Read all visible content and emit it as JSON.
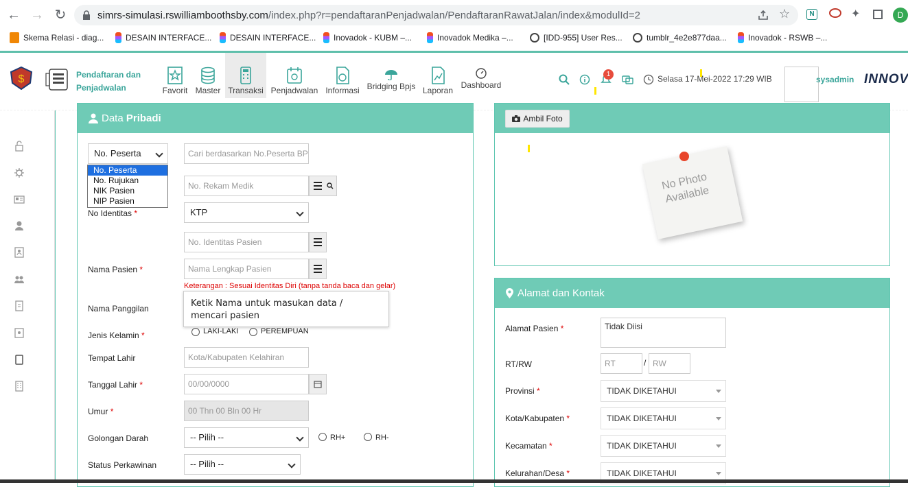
{
  "browser": {
    "url_host": "simrs-simulasi.rswilliamboothsby.com",
    "url_path": "/index.php?r=pendaftaranPenjadwalan/PendaftaranRawatJalan/index&modulId=2",
    "profile_initial": "D",
    "bookmarks": [
      {
        "label": "Skema Relasi - diag...",
        "icon": "drawio-icon"
      },
      {
        "label": "DESAIN INTERFACE...",
        "icon": "figma-icon"
      },
      {
        "label": "DESAIN INTERFACE...",
        "icon": "figma-icon"
      },
      {
        "label": "Inovadok - KUBM –...",
        "icon": "figma-icon"
      },
      {
        "label": "Inovadok Medika –...",
        "icon": "figma-icon"
      },
      {
        "label": "[IDD-955] User Res...",
        "icon": "globe-icon"
      },
      {
        "label": "tumblr_4e2e877daa...",
        "icon": "globe-icon"
      },
      {
        "label": "Inovadok - RSWB –...",
        "icon": "figma-icon"
      }
    ]
  },
  "header": {
    "module_title_line1": "Pendaftaran dan",
    "module_title_line2": "Penjadwalan",
    "menu": [
      {
        "label": "Favorit",
        "icon": "star-icon"
      },
      {
        "label": "Master",
        "icon": "database-icon"
      },
      {
        "label": "Transaksi",
        "icon": "calculator-icon"
      },
      {
        "label": "Penjadwalan",
        "icon": "calendar-icon"
      },
      {
        "label": "Informasi",
        "icon": "info-icon"
      },
      {
        "label": "Bridging Bpjs",
        "icon": "umbrella-icon"
      },
      {
        "label": "Laporan",
        "icon": "report-icon"
      },
      {
        "label": "Dashboard",
        "icon": "dashboard-icon"
      }
    ],
    "notification_count": "1",
    "datetime": "Selasa 17-Mei-2022 17:29 WIB",
    "username": "sysadmin",
    "brand": "INNOV"
  },
  "data_pribadi": {
    "title_light": "Data",
    "title_bold": "Pribadi",
    "id_type_selected": "No. Peserta",
    "id_type_options": [
      "No. Peserta",
      "No. Rujukan",
      "NIK Pasien",
      "NIP Pasien"
    ],
    "search_placeholder": "Cari berdasarkan No.Peserta BPJS",
    "rekam_medik_placeholder": "No. Rekam Medik",
    "no_identitas_label": "No Identitas",
    "identitas_type": "KTP",
    "no_identitas_placeholder": "No. Identitas Pasien",
    "nama_pasien_label": "Nama Pasien",
    "nama_pasien_placeholder": "Nama Lengkap Pasien",
    "keterangan": "Keterangan : Sesuai Identitas Diri (tanpa tanda baca dan gelar)",
    "tooltip": "Ketik Nama untuk masukan data / mencari pasien",
    "nama_panggilan_label": "Nama Panggilan",
    "jenis_kelamin_label": "Jenis Kelamin",
    "gender_options": [
      "LAKI-LAKI",
      "PEREMPUAN"
    ],
    "tempat_lahir_label": "Tempat Lahir",
    "tempat_lahir_placeholder": "Kota/Kabupaten Kelahiran",
    "tanggal_lahir_label": "Tanggal Lahir",
    "tanggal_lahir_placeholder": "00/00/0000",
    "umur_label": "Umur",
    "umur_value": "00 Thn 00 Bln 00 Hr",
    "golongan_darah_label": "Golongan Darah",
    "golongan_darah_value": "-- Pilih --",
    "rhesus_options": [
      "RH+",
      "RH-"
    ],
    "status_perkawinan_label": "Status Perkawinan",
    "status_perkawinan_value": "-- Pilih --"
  },
  "photo": {
    "button_label": "Ambil Foto",
    "placeholder_line1": "No Photo",
    "placeholder_line2": "Available"
  },
  "alamat": {
    "title": "Alamat dan Kontak",
    "alamat_label": "Alamat Pasien",
    "alamat_value": "Tidak Diisi",
    "rtrw_label": "RT/RW",
    "rt_placeholder": "RT",
    "rw_placeholder": "RW",
    "slash": "/",
    "provinsi_label": "Provinsi",
    "provinsi_value": "TIDAK DIKETAHUI",
    "kota_label": "Kota/Kabupaten",
    "kota_value": "TIDAK DIKETAHUI",
    "kecamatan_label": "Kecamatan",
    "kecamatan_value": "TIDAK DIKETAHUI",
    "kelurahan_label": "Kelurahan/Desa",
    "kelurahan_value": "TIDAK DIKETAHUI"
  },
  "required_mark": "*"
}
